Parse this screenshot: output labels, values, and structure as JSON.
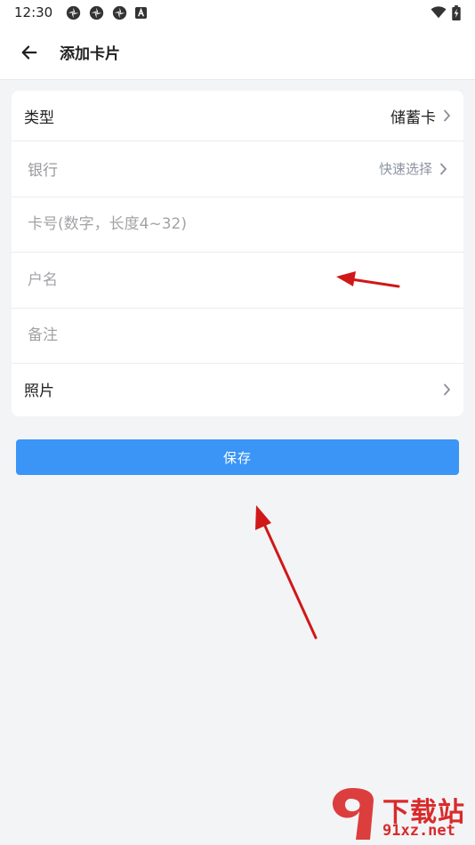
{
  "status_bar": {
    "time": "12:30",
    "left_icons": [
      "pinwheel-icon",
      "pinwheel-icon",
      "pinwheel-icon",
      "a-badge-icon"
    ],
    "right_icons": [
      "wifi-icon",
      "battery-charging-icon"
    ]
  },
  "header": {
    "back_icon": "arrow-left-icon",
    "title": "添加卡片"
  },
  "form": {
    "type": {
      "label": "类型",
      "value": "储蓄卡"
    },
    "bank": {
      "label": "银行",
      "hint": "快速选择"
    },
    "card_number": {
      "placeholder": "卡号(数字，长度4~32)"
    },
    "account_name": {
      "placeholder": "户名"
    },
    "note": {
      "placeholder": "备注"
    },
    "photo": {
      "label": "照片"
    }
  },
  "actions": {
    "save_label": "保存"
  },
  "annotations": {
    "arrow_color": "#d01818"
  },
  "watermark": {
    "top": "下载站",
    "bottom": "91xz.net"
  },
  "colors": {
    "primary": "#3a95f6",
    "background": "#f3f4f6",
    "card": "#ffffff"
  }
}
